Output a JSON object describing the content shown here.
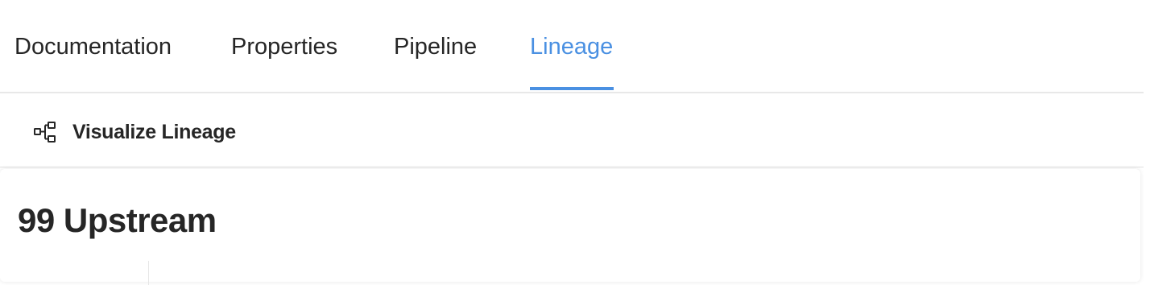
{
  "tabs": [
    {
      "label": "Documentation",
      "active": false
    },
    {
      "label": "Properties",
      "active": false
    },
    {
      "label": "Pipeline",
      "active": false
    },
    {
      "label": "Lineage",
      "active": true
    }
  ],
  "toolbar": {
    "visualize_label": "Visualize Lineage",
    "visualize_icon": "lineage-graph-icon"
  },
  "upstream": {
    "title": "99 Upstream"
  },
  "colors": {
    "accent": "#4a90e2",
    "text": "#262626",
    "border": "#e8e8e8"
  }
}
